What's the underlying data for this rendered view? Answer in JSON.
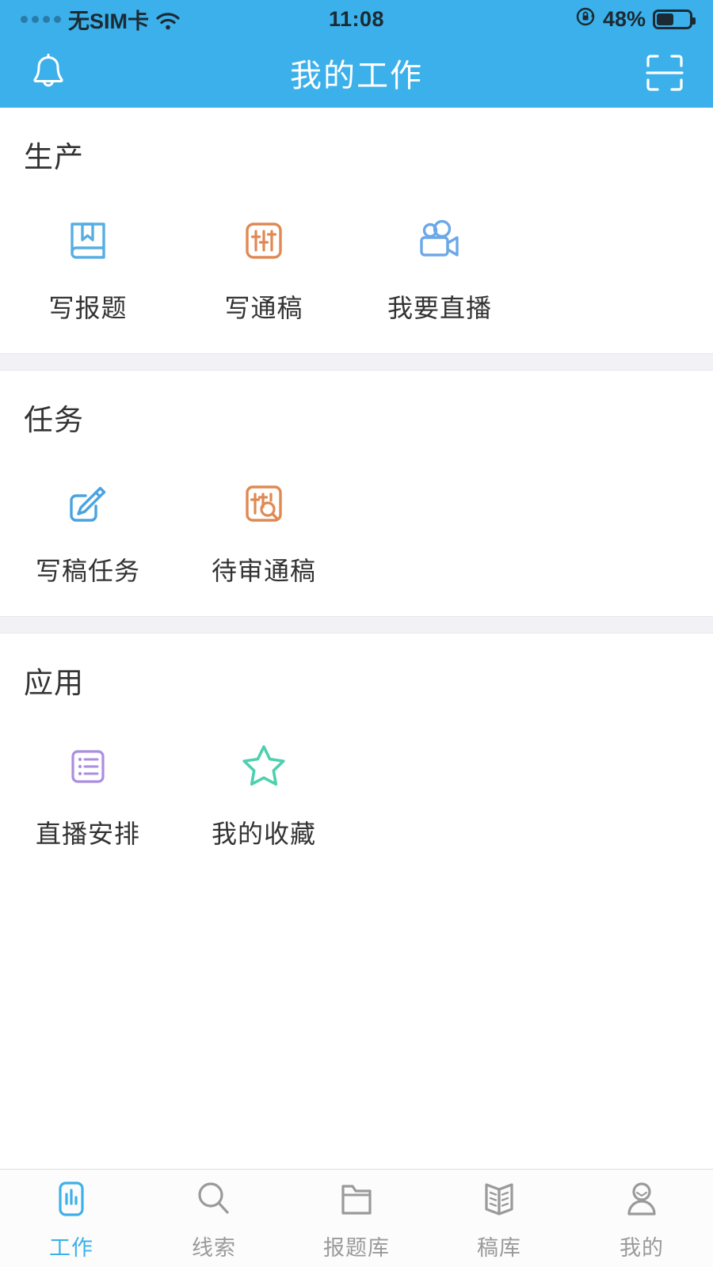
{
  "status_bar": {
    "carrier": "无SIM卡",
    "signal_icon": "signal-dots-icon",
    "wifi_icon": "wifi-icon",
    "time": "11:08",
    "rotation_lock_icon": "rotation-lock-icon",
    "battery_percent": "48%",
    "battery_icon": "battery-icon",
    "battery_level": 48
  },
  "header": {
    "title": "我的工作",
    "left_icon": "bell-icon",
    "right_icon": "scan-qr-icon",
    "background_color": "#3cb0ea",
    "title_color": "#ffffff"
  },
  "sections": [
    {
      "title": "生产",
      "items": [
        {
          "label": "写报题",
          "icon": "book-bookmark-icon",
          "color": "#56aee3"
        },
        {
          "label": "写通稿",
          "icon": "sliders-box-icon",
          "color": "#e08953"
        },
        {
          "label": "我要直播",
          "icon": "video-camera-icon",
          "color": "#6ca8e8"
        }
      ]
    },
    {
      "title": "任务",
      "items": [
        {
          "label": "写稿任务",
          "icon": "edit-pencil-box-icon",
          "color": "#4aa3e0"
        },
        {
          "label": "待审通稿",
          "icon": "sliders-search-box-icon",
          "color": "#e08953"
        }
      ]
    },
    {
      "title": "应用",
      "items": [
        {
          "label": "直播安排",
          "icon": "list-box-icon",
          "color": "#ab8ee0"
        },
        {
          "label": "我的收藏",
          "icon": "star-icon",
          "color": "#4dd0ae"
        }
      ]
    }
  ],
  "tab_bar": {
    "active_index": 0,
    "active_color": "#3cb0ea",
    "inactive_color": "#9a9a9a",
    "tabs": [
      {
        "label": "工作",
        "icon": "work-chart-icon"
      },
      {
        "label": "线索",
        "icon": "search-icon"
      },
      {
        "label": "报题库",
        "icon": "folder-icon"
      },
      {
        "label": "稿库",
        "icon": "open-book-icon"
      },
      {
        "label": "我的",
        "icon": "person-icon"
      }
    ]
  }
}
